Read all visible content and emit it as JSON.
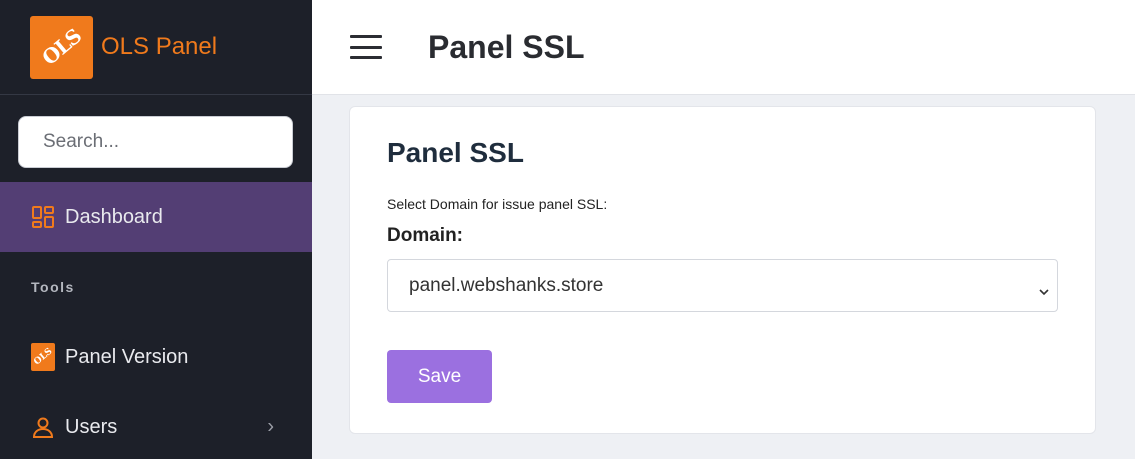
{
  "brand": {
    "logo_text": "OLS",
    "name": "OLS Panel"
  },
  "sidebar": {
    "search_placeholder": "Search...",
    "dashboard_label": "Dashboard",
    "section_tools": "Tools",
    "items": [
      {
        "label": "Panel Version",
        "icon": "ols-logo-icon"
      },
      {
        "label": "Users",
        "icon": "user-icon"
      }
    ]
  },
  "header": {
    "title": "Panel SSL",
    "menu_icon": "hamburger-menu-icon"
  },
  "main": {
    "card_title": "Panel SSL",
    "description": "Select Domain for issue panel SSL:",
    "domain_label": "Domain:",
    "domain_value": "panel.webshanks.store",
    "save_label": "Save"
  },
  "colors": {
    "sidebar_bg": "#1d2029",
    "accent_orange": "#f07a1c",
    "active_item_bg": "#533e74",
    "save_button": "#9b70e0"
  }
}
